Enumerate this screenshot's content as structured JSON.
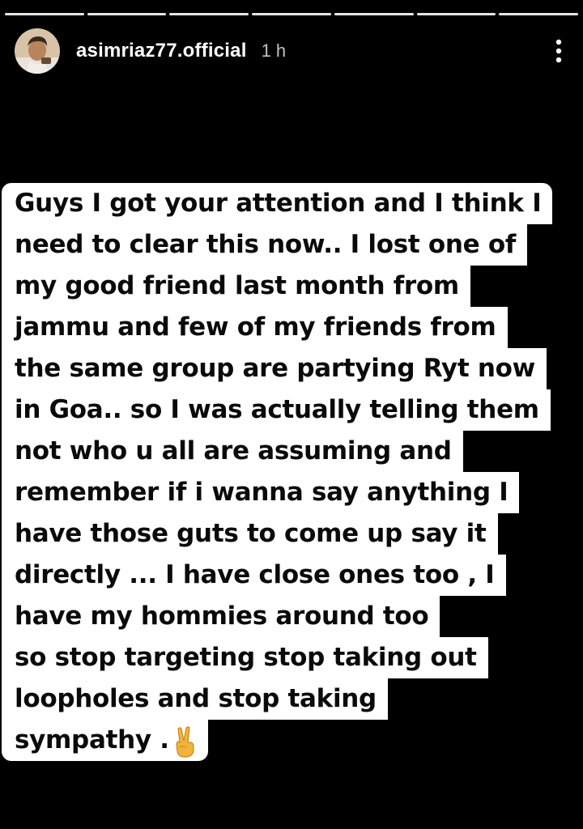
{
  "story": {
    "segments_total": 7,
    "segments_viewed": 7
  },
  "header": {
    "username": "asimriaz77.official",
    "time": "1 h",
    "avatar_icon": "avatar",
    "more_icon": "more-vertical-icon"
  },
  "caption": {
    "lines": [
      "Guys I got your attention and I think I",
      "need to clear this now.. I lost one of",
      "my good friend last month from",
      "jammu and few of my friends from",
      "the same group are partying Ryt now",
      "in Goa.. so I was actually telling them",
      "not who u all are assuming and",
      "remember if i wanna say anything I",
      "have those guts to come up say it",
      "directly ... I have close ones too , I",
      "have my hommies around too",
      "so stop targeting stop taking out",
      "loopholes and stop taking",
      "sympathy ."
    ],
    "trailing_emoji": "victory-hand-emoji"
  },
  "colors": {
    "background": "#000000",
    "caption_bg": "#ffffff",
    "caption_text": "#0a0a0a",
    "emoji": "#f2b33d"
  }
}
